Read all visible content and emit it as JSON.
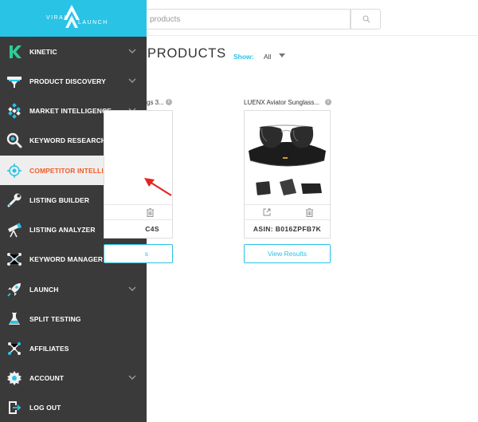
{
  "logo": {
    "left_text": "VIRAL",
    "right_text": "LAUNCH"
  },
  "sidebar": {
    "items": [
      {
        "label": "KINETIC",
        "icon": "kinetic-k-icon",
        "has_chevron": true
      },
      {
        "label": "PRODUCT DISCOVERY",
        "icon": "funnel-icon",
        "has_chevron": true
      },
      {
        "label": "MARKET INTELLIGENCE",
        "icon": "diamond-grid-icon",
        "has_chevron": true
      },
      {
        "label": "KEYWORD RESEARCH",
        "icon": "magnifier-icon",
        "has_chevron": true
      },
      {
        "label": "COMPETITOR INTELLIGENCE",
        "icon": "target-icon",
        "has_chevron": false,
        "active": true
      },
      {
        "label": "LISTING BUILDER",
        "icon": "wrench-icon",
        "has_chevron": true
      },
      {
        "label": "LISTING ANALYZER",
        "icon": "telescope-icon",
        "has_chevron": false
      },
      {
        "label": "KEYWORD MANAGER",
        "icon": "network-icon",
        "has_chevron": false
      },
      {
        "label": "LAUNCH",
        "icon": "rocket-icon",
        "has_chevron": true
      },
      {
        "label": "SPLIT TESTING",
        "icon": "flask-icon",
        "has_chevron": false
      },
      {
        "label": "AFFILIATES",
        "icon": "nodes-icon",
        "has_chevron": false
      },
      {
        "label": "ACCOUNT",
        "icon": "gear-icon",
        "has_chevron": true
      },
      {
        "label": "LOG OUT",
        "icon": "logout-icon",
        "has_chevron": false
      }
    ]
  },
  "search": {
    "placeholder": "products"
  },
  "main": {
    "title": "PRODUCTS",
    "show_label": "Show:",
    "show_value": "All"
  },
  "cards": [
    {
      "title": "gs 3...",
      "asin": "C4S",
      "button": "s"
    },
    {
      "title": "LUENX Aviator Sunglass...",
      "asin": "ASIN: B016ZPFB7K",
      "button": "View Results"
    }
  ],
  "colors": {
    "accent": "#29c3e6",
    "active_text": "#f05a28",
    "sidebar_bg": "#3a3a3a",
    "arrow": "#e8231e"
  }
}
